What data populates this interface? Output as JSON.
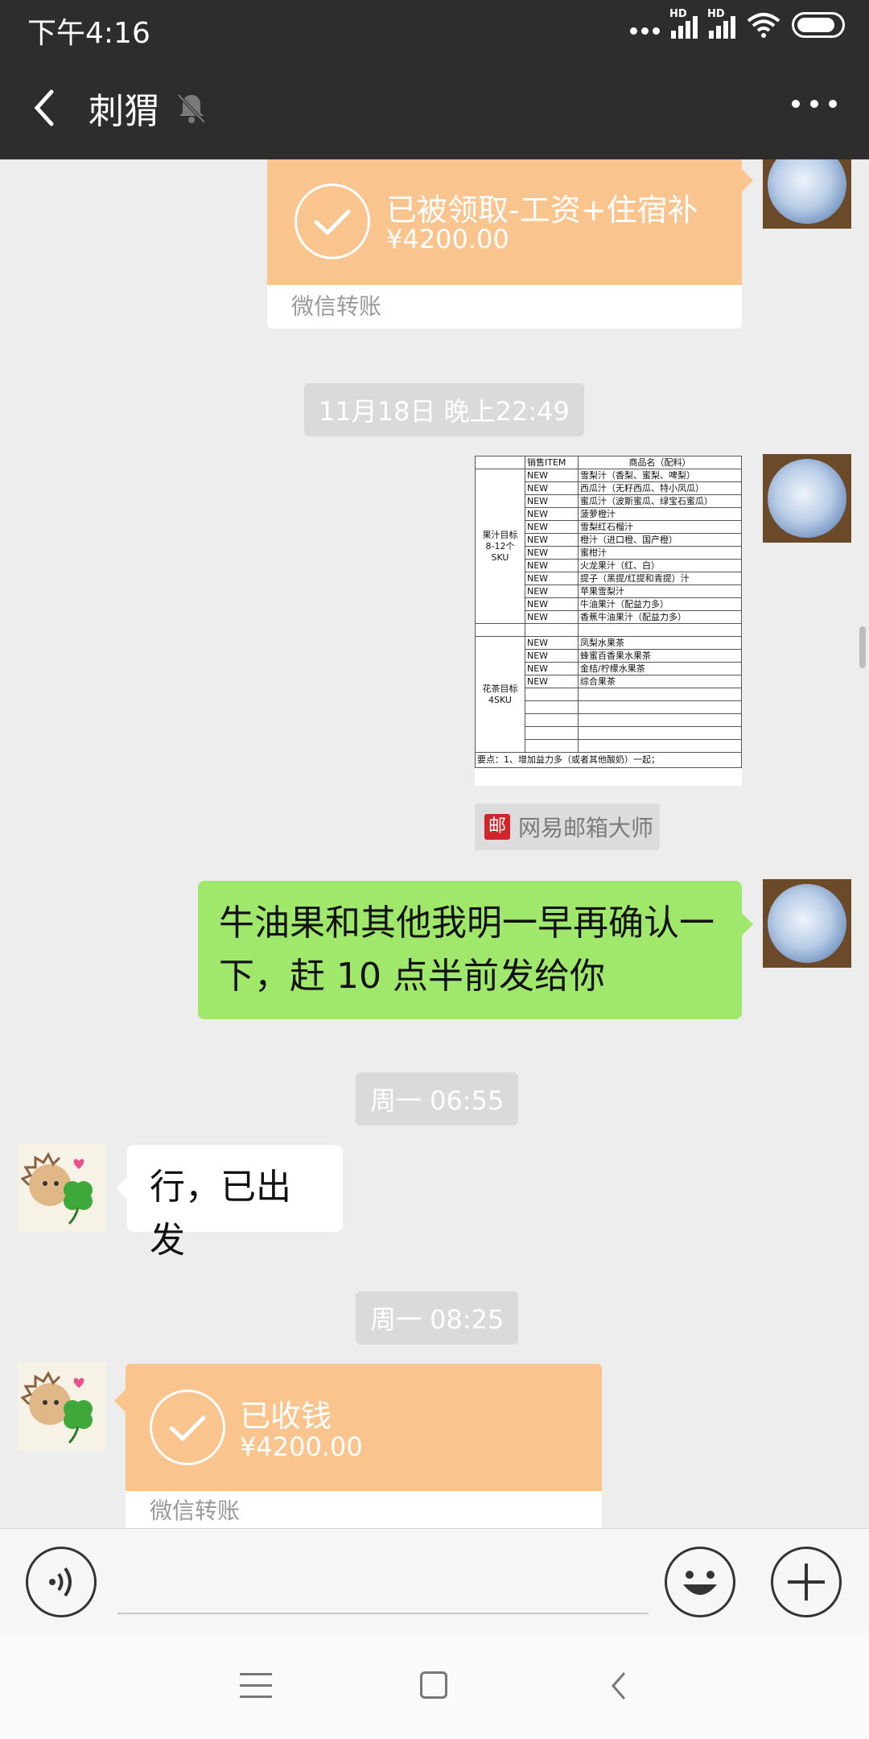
{
  "status_bar": {
    "time": "下午4:16",
    "network_label": "HD"
  },
  "header": {
    "title": "刺猬",
    "back_icon": "chevron-left-icon",
    "mute_icon": "bell-muted-icon",
    "more_icon": "more-dots-icon"
  },
  "messages": {
    "transfer_received": {
      "title": "已被领取-工资+住宿补",
      "amount": "¥4200.00",
      "footer": "微信转账"
    },
    "time1": "11月18日 晚上22:49",
    "spreadsheet": {
      "header": [
        "",
        "销售ITEM",
        "商品名（配料）"
      ],
      "group1_label": "果汁目标 8-12个 SKU",
      "group1_rows": [
        [
          "NEW",
          "雪梨汁（香梨、蜜梨、啤梨）"
        ],
        [
          "NEW",
          "西瓜汁（无籽西瓜、特小凤瓜）"
        ],
        [
          "NEW",
          "蜜瓜汁（波斯蜜瓜、绿宝石蜜瓜）"
        ],
        [
          "NEW",
          "菠萝橙汁"
        ],
        [
          "NEW",
          "雪梨红石榴汁"
        ],
        [
          "NEW",
          "橙汁（进口橙、国产橙）"
        ],
        [
          "NEW",
          "蜜柑汁"
        ],
        [
          "NEW",
          "火龙果汁（红、白）"
        ],
        [
          "NEW",
          "提子（黑提/红提和青提）汁"
        ],
        [
          "NEW",
          "苹果雪梨汁"
        ],
        [
          "NEW",
          "牛油果汁（配益力多）"
        ],
        [
          "NEW",
          "香蕉牛油果汁（配益力多）"
        ]
      ],
      "group2_label": "花茶目标 4SKU",
      "group2_rows": [
        [
          "NEW",
          "凤梨水果茶"
        ],
        [
          "NEW",
          "蜂蜜百香果水果茶"
        ],
        [
          "NEW",
          "金桔/柠檬水果茶"
        ],
        [
          "NEW",
          "综合果茶"
        ],
        [
          "",
          ""
        ],
        [
          "",
          ""
        ],
        [
          "",
          ""
        ],
        [
          "",
          ""
        ],
        [
          "",
          ""
        ]
      ],
      "note": "要点：1、增加益力多（或者其他酸奶）一起；"
    },
    "mail_source": "网易邮箱大师",
    "mail_logo": "邮",
    "bubble_me": "牛油果和其他我明一早再确认一下，赶 10 点半前发给你",
    "time2": "周一 06:55",
    "bubble_friend": "行，已出发",
    "time3": "周一 08:25",
    "transfer_collected": {
      "title": "已收钱",
      "amount": "¥4200.00",
      "footer": "微信转账"
    }
  },
  "input_bar": {
    "voice_icon": "voice-icon",
    "input_value": "",
    "emoji_icon": "emoji-icon",
    "plus_icon": "plus-icon"
  },
  "nav_bar": {
    "menu_icon": "menu-icon",
    "home_icon": "home-icon",
    "back_icon": "back-icon"
  },
  "colors": {
    "bar_dark": "#2d2d2d",
    "chat_bg": "#ededed",
    "transfer_orange": "#f9c48e",
    "bubble_green": "#9fe86b"
  }
}
